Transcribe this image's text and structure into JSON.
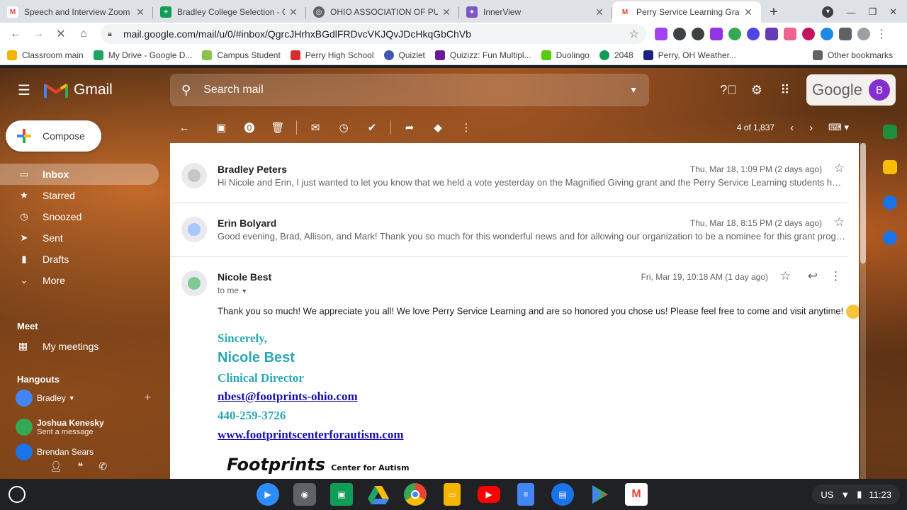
{
  "browser": {
    "tabs": [
      {
        "title": "Speech and Interview Zoom Li",
        "fav_color": "#ea4335",
        "fav_glyph": "M"
      },
      {
        "title": "Bradley College Selection - Goo",
        "fav_color": "#0f9d58",
        "fav_glyph": "+"
      },
      {
        "title": "OHIO ASSOCIATION OF PUBLIC",
        "fav_color": "#5f6368",
        "fav_glyph": "◎"
      },
      {
        "title": "InnerView",
        "fav_color": "#7e57c2",
        "fav_glyph": "✦"
      },
      {
        "title": "Perry Service Learning Grant -",
        "fav_color": "#ea4335",
        "fav_glyph": "M"
      }
    ],
    "url": "mail.google.com/mail/u/0/#inbox/QgrcJHrhxBGdlFRDvcVKJQvJDcHkqGbChVb",
    "bookmarks": [
      {
        "label": "Classroom main",
        "color": "#f4b400"
      },
      {
        "label": "My Drive - Google D...",
        "color": "#1fa463"
      },
      {
        "label": "Campus Student",
        "color": "#8bc34a"
      },
      {
        "label": "Perry High School",
        "color": "#d32f2f"
      },
      {
        "label": "Quizlet",
        "color": "#4257b2"
      },
      {
        "label": "Quizizz: Fun Multipl...",
        "color": "#6a1b9a"
      },
      {
        "label": "Duolingo",
        "color": "#58cc02"
      },
      {
        "label": "2048",
        "color": "#0f9d58"
      },
      {
        "label": "Perry, OH Weather...",
        "color": "#1a237e"
      }
    ],
    "other_bookmarks": "Other bookmarks"
  },
  "gmail": {
    "app_name": "Gmail",
    "search_placeholder": "Search mail",
    "google_word": "Google",
    "avatar_letter": "B",
    "compose": "Compose",
    "nav": [
      {
        "label": "Inbox",
        "icon": "inbox-icon",
        "glyph": "▭"
      },
      {
        "label": "Starred",
        "icon": "star-icon",
        "glyph": "★"
      },
      {
        "label": "Snoozed",
        "icon": "clock-icon",
        "glyph": "◷"
      },
      {
        "label": "Sent",
        "icon": "send-icon",
        "glyph": "➤"
      },
      {
        "label": "Drafts",
        "icon": "draft-icon",
        "glyph": "▮"
      },
      {
        "label": "More",
        "icon": "chevron-down-icon",
        "glyph": "⌄"
      }
    ],
    "meet_title": "Meet",
    "my_meetings": "My meetings",
    "hangouts_title": "Hangouts",
    "hangouts": [
      {
        "name": "Bradley",
        "sub": "",
        "color": "#4285f4"
      },
      {
        "name": "Joshua Kenesky",
        "sub": "Sent a message",
        "color": "#34a853"
      },
      {
        "name": "Brendan Sears",
        "sub": "",
        "color": "#1a73e8"
      }
    ],
    "pagination": "4 of 1,837"
  },
  "messages": [
    {
      "sender": "Bradley Peters",
      "date": "Thu, Mar 18, 1:09 PM (2 days ago)",
      "snippet": "Hi Nicole and Erin, I just wanted to let you know that we held a vote yesterday on the Magnified Giving grant and the Perry Service Learning students have ..."
    },
    {
      "sender": "Erin Bolyard",
      "date": "Thu, Mar 18, 8:15 PM (2 days ago)",
      "snippet": "Good evening, Brad, Allison, and Mark! Thank you so much for this wonderful news and for allowing our organization to be a nominee for this grant program!..."
    },
    {
      "sender": "Nicole Best",
      "date": "Fri, Mar 19, 10:18 AM (1 day ago)",
      "to": "to me",
      "body": "Thank you so much! We appreciate you all! We love Perry Service Learning and are so honored you chose us! Please feel free to come and visit anytime!"
    }
  ],
  "signature": {
    "closing": "Sincerely,",
    "name": "Nicole Best",
    "title": "Clinical Director",
    "email": "nbest@footprints-ohio.com",
    "phone": "440-259-3726",
    "website": "www.footprintscenterforautism.com",
    "logo_word": "Footprints",
    "logo_sub": "Center for Autism"
  },
  "shelf": {
    "locale": "US",
    "time": "11:23",
    "apps": [
      {
        "name": "zoom-app",
        "color": "#2d8cff"
      },
      {
        "name": "camera-app",
        "color": "#5f6368"
      },
      {
        "name": "classroom-app",
        "color": "#0f9d58"
      },
      {
        "name": "drive-app",
        "color": "#fbbc04"
      },
      {
        "name": "chrome-app",
        "color": "#4285f4"
      },
      {
        "name": "slides-app",
        "color": "#f4b400"
      },
      {
        "name": "youtube-app",
        "color": "#ff0000"
      },
      {
        "name": "docs-app",
        "color": "#4285f4"
      },
      {
        "name": "files-app",
        "color": "#1a73e8"
      },
      {
        "name": "play-store-app",
        "color": "#34a853"
      },
      {
        "name": "gmail-app",
        "color": "#ea4335"
      }
    ]
  }
}
